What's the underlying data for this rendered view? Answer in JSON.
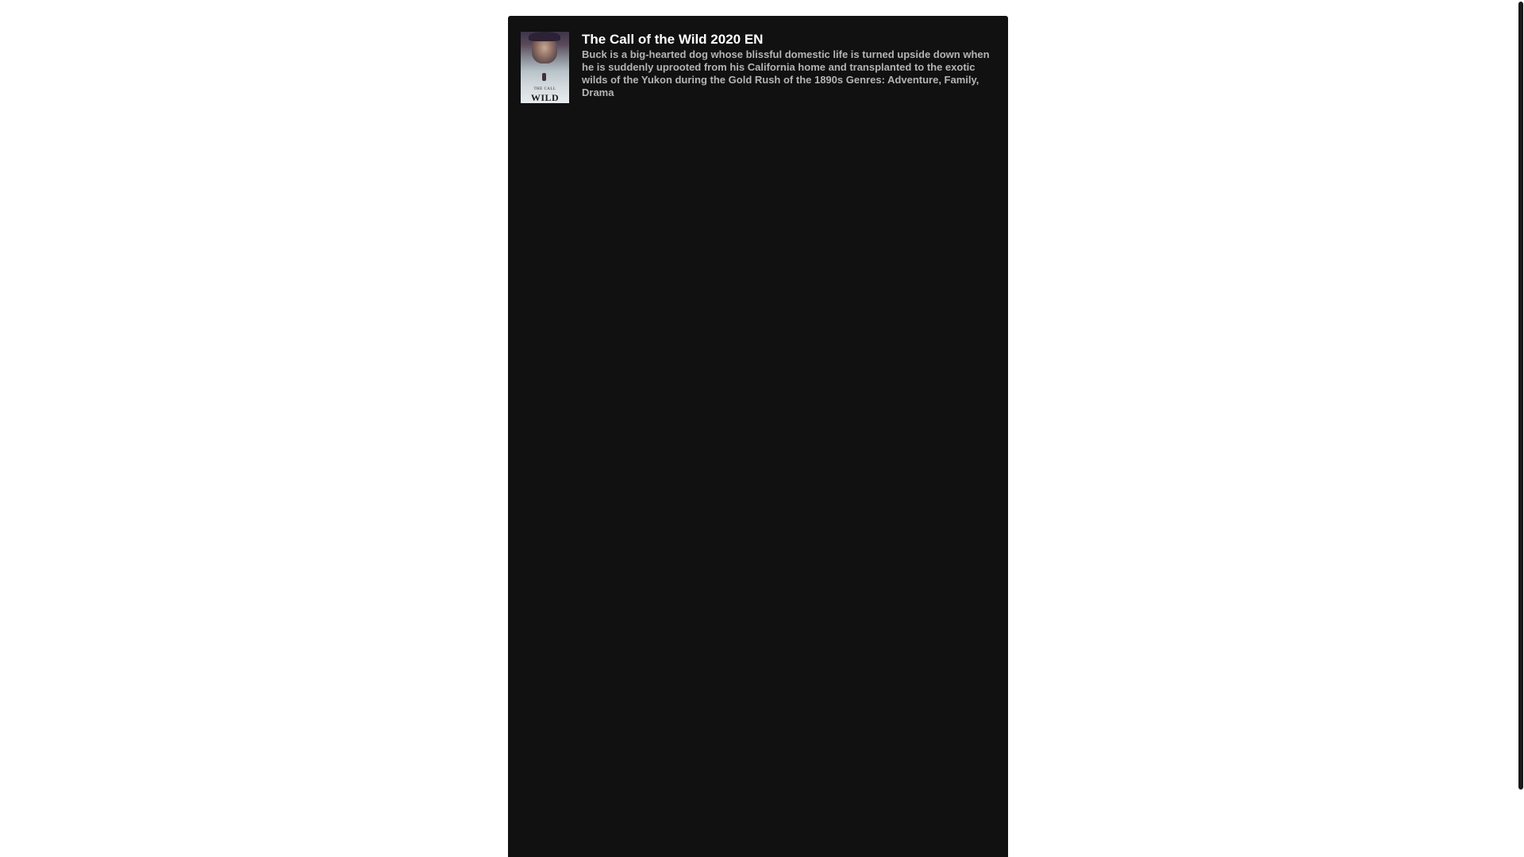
{
  "movie": {
    "title": "The Call of the Wild 2020 EN",
    "description": "Buck is a big-hearted dog whose blissful domestic life is turned upside down when he is suddenly uprooted from his California home and transplanted to the exotic wilds of the Yukon during the Gold Rush of the 1890s",
    "genres_label": "Genres:",
    "genres": "Adventure, Family, Drama",
    "poster": {
      "line1": "THE CALL",
      "line2": "WILD"
    }
  },
  "colors": {
    "panel_background": "#111111",
    "title_color": "#ffffff",
    "description_color": "#b4b4b4",
    "page_background": "#ffffff"
  }
}
